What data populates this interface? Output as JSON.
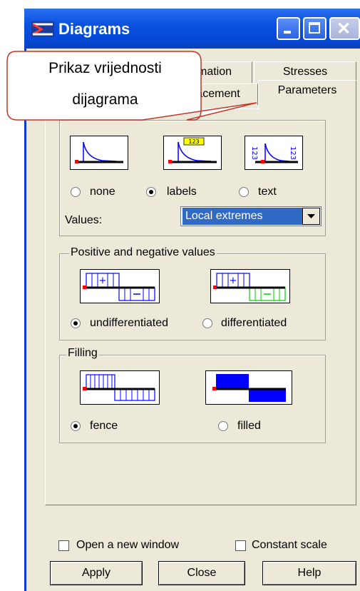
{
  "window": {
    "title": "Diagrams"
  },
  "tabs": {
    "row1": [
      {
        "label": "mation"
      },
      {
        "label": "Stresses"
      }
    ],
    "row2": [
      {
        "label": "acement"
      },
      {
        "label": "Parameters"
      }
    ]
  },
  "callout": {
    "line1": "Prikaz vrijednosti",
    "line2": "dijagrama"
  },
  "display_group": {
    "icon_text": "123",
    "options": [
      {
        "label": "none",
        "selected": false
      },
      {
        "label": "labels",
        "selected": true
      },
      {
        "label": "text",
        "selected": false
      }
    ],
    "values_label": "Values:",
    "values_selected": "Local extremes"
  },
  "posneg_group": {
    "title": "Positive and negative values",
    "options": [
      {
        "label": "undifferentiated",
        "selected": true
      },
      {
        "label": "differentiated",
        "selected": false
      }
    ]
  },
  "filling_group": {
    "title": "Filling",
    "options": [
      {
        "label": "fence",
        "selected": true
      },
      {
        "label": "filled",
        "selected": false
      }
    ]
  },
  "checkboxes": [
    {
      "label": "Open a new window",
      "checked": false
    },
    {
      "label": "Constant scale",
      "checked": false
    }
  ],
  "buttons": {
    "apply": "Apply",
    "close": "Close",
    "help": "Help"
  },
  "colors": {
    "accent_blue": "#0000ff",
    "marker_red": "#ff0000",
    "green": "#00cc00",
    "yellow": "#ffff00"
  }
}
